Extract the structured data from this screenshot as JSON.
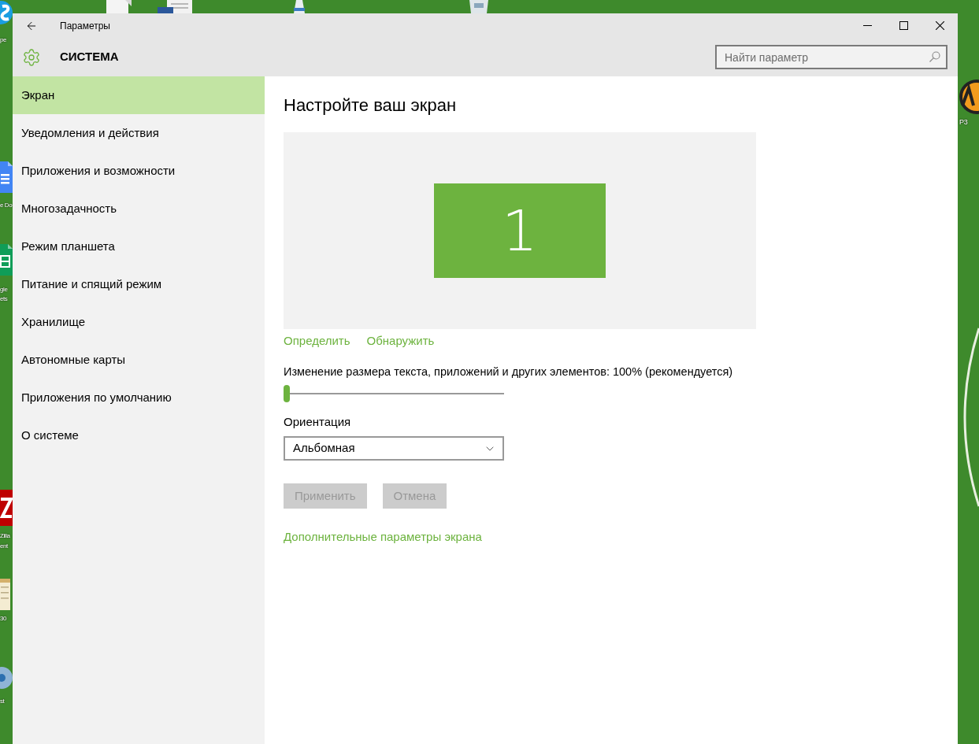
{
  "desktop": {
    "icons": [
      {
        "label_lines": [
          "pe"
        ]
      },
      {
        "label_lines": [
          "e Do"
        ]
      },
      {
        "label_lines": [
          "gle",
          "ets"
        ]
      },
      {
        "label_lines": [
          "Zilla",
          "ent"
        ]
      },
      {
        "label_lines": [
          "30"
        ]
      },
      {
        "label_lines": [
          "st"
        ]
      },
      {
        "label_lines": [
          "P3"
        ]
      }
    ]
  },
  "window": {
    "title": "Параметры",
    "section": "СИСТЕМА",
    "search": {
      "placeholder": "Найти параметр"
    }
  },
  "sidebar": {
    "items": [
      {
        "label": "Экран",
        "selected": true
      },
      {
        "label": "Уведомления и действия",
        "selected": false
      },
      {
        "label": "Приложения и возможности",
        "selected": false
      },
      {
        "label": "Многозадачность",
        "selected": false
      },
      {
        "label": "Режим планшета",
        "selected": false
      },
      {
        "label": "Питание и спящий режим",
        "selected": false
      },
      {
        "label": "Хранилище",
        "selected": false
      },
      {
        "label": "Автономные карты",
        "selected": false
      },
      {
        "label": "Приложения по умолчанию",
        "selected": false
      },
      {
        "label": "О системе",
        "selected": false
      }
    ]
  },
  "content": {
    "heading": "Настройте ваш экран",
    "display_preview": {
      "monitors": [
        {
          "number": "1"
        }
      ]
    },
    "links": [
      "Определить",
      "Обнаружить"
    ],
    "scale": {
      "label": "Изменение размера текста, приложений и других элементов: 100% (рекомендуется)",
      "level": 0
    },
    "orientation": {
      "label": "Ориентация",
      "value": "Альбомная"
    },
    "buttons": [
      {
        "label": "Применить",
        "disabled": true
      },
      {
        "label": "Отмена",
        "disabled": true
      }
    ],
    "advanced_link": "Дополнительные параметры экрана"
  }
}
